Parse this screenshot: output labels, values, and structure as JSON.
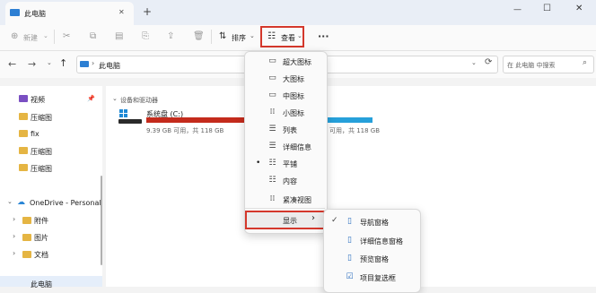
{
  "window": {
    "tab_title": "此电脑",
    "new_tab": "+",
    "close": "✕",
    "minimize": "—",
    "maximize": "☐"
  },
  "toolbar": {
    "new_label": "新建",
    "sort_label": "排序",
    "view_label": "查看",
    "more": "···"
  },
  "address": {
    "path": "此电脑",
    "search_placeholder": "在 此电脑 中搜索"
  },
  "sidebar": {
    "items": [
      {
        "label": "视频",
        "pinned": true
      },
      {
        "label": "压缩图"
      },
      {
        "label": "fix"
      },
      {
        "label": "压缩图"
      },
      {
        "label": "压缩图"
      },
      {
        "label": "OneDrive - Personal"
      },
      {
        "label": "附件"
      },
      {
        "label": "图片"
      },
      {
        "label": "文档"
      },
      {
        "label": "此电脑"
      }
    ]
  },
  "main": {
    "section_title": "设备和驱动器",
    "drives": [
      {
        "name": "系统盘 (C:)",
        "free": "9.39 GB 可用，共 118 GB",
        "used_fraction": 0.92
      },
      {
        "name": "",
        "free": "可用，共 118 GB",
        "used_fraction": 0.08
      }
    ]
  },
  "view_menu": {
    "items": [
      {
        "icon": "▭",
        "label": "超大图标"
      },
      {
        "icon": "▭",
        "label": "大图标"
      },
      {
        "icon": "▭",
        "label": "中图标"
      },
      {
        "icon": "⁞⁞",
        "label": "小图标"
      },
      {
        "icon": "☰",
        "label": "列表"
      },
      {
        "icon": "☰",
        "label": "详细信息"
      },
      {
        "icon": "☷",
        "label": "平铺",
        "selected": true
      },
      {
        "icon": "☷",
        "label": "内容"
      },
      {
        "icon": "⁞⁞",
        "label": "紧凑视图"
      }
    ],
    "show_label": "显示",
    "show_arrow": "›"
  },
  "show_submenu": {
    "items": [
      {
        "icon": "▯",
        "label": "导航窗格",
        "checked": true
      },
      {
        "icon": "▯",
        "label": "详细信息窗格"
      },
      {
        "icon": "▯",
        "label": "预览窗格"
      },
      {
        "icon": "☑",
        "label": "项目复选框"
      }
    ]
  },
  "colors": {
    "accent": "#0067c0",
    "drive_full": "#c42b1c",
    "drive_ok": "#26a0da",
    "highlight": "#d4382c"
  }
}
